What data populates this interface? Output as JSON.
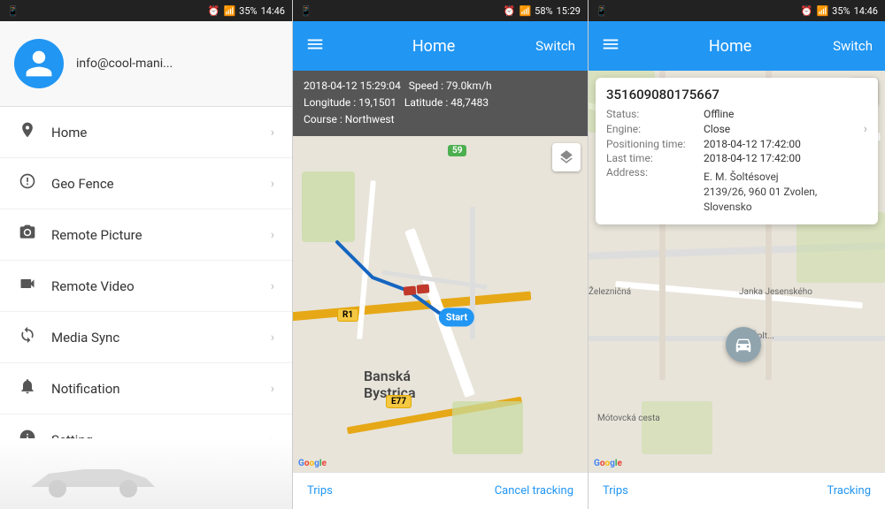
{
  "panel_left": {
    "status_bar": {
      "left": "📱",
      "time": "14:46",
      "battery": "35%"
    },
    "user": {
      "email": "info@cool-mani..."
    },
    "nav_items": [
      {
        "id": "home",
        "label": "Home",
        "icon": "📍"
      },
      {
        "id": "geo-fence",
        "label": "Geo Fence",
        "icon": "⚙"
      },
      {
        "id": "remote-picture",
        "label": "Remote Picture",
        "icon": "📷"
      },
      {
        "id": "remote-video",
        "label": "Remote Video",
        "icon": "🎥"
      },
      {
        "id": "media-sync",
        "label": "Media Sync",
        "icon": "↻"
      },
      {
        "id": "notification",
        "label": "Notification",
        "icon": "🔔"
      },
      {
        "id": "setting",
        "label": "Setting",
        "icon": "ℹ"
      }
    ]
  },
  "panel_middle": {
    "status_bar": {
      "time": "15:29",
      "battery": "58%"
    },
    "header": {
      "title": "Home",
      "switch_label": "Switch"
    },
    "trip_info": {
      "datetime": "2018-04-12 15:29:04",
      "speed": "Speed : 79.0km/h",
      "longitude": "Longitude : 19,1501",
      "latitude": "Latitude : 48,7483",
      "course": "Course : Northwest"
    },
    "map": {
      "city_label": "Banská\nBystrica",
      "start_label": "Start"
    },
    "footer": {
      "trips_label": "Trips",
      "cancel_tracking_label": "Cancel tracking"
    }
  },
  "panel_right": {
    "status_bar": {
      "time": "14:46",
      "battery": "35%"
    },
    "header": {
      "title": "Home",
      "switch_label": "Switch"
    },
    "device_info": {
      "device_id": "351609080175667",
      "status_label": "Status:",
      "status_value": "Offline",
      "engine_label": "Engine:",
      "engine_value": "Close",
      "positioning_label": "Positioning time:",
      "positioning_value": "2018-04-12 17:42:00",
      "last_time_label": "Last time:",
      "last_time_value": "2018-04-12 17:42:00",
      "address_label": "Address:",
      "address_value": "E. M. Šoltésovej\n2139/26, 960 01 Zvolen, Slovensko"
    },
    "footer": {
      "trips_label": "Trips",
      "tracking_label": "Tracking"
    }
  }
}
